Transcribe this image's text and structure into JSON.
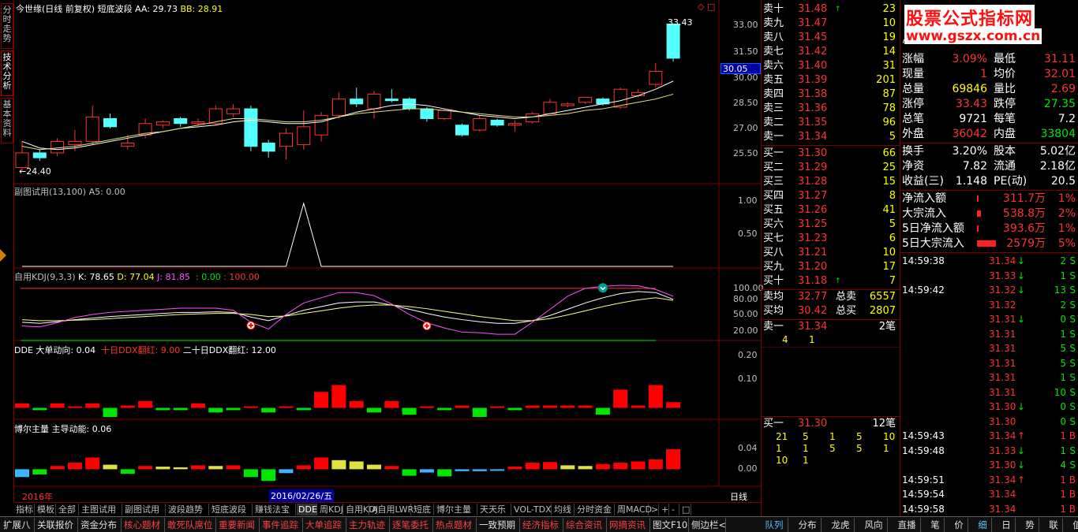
{
  "left_tabs": [
    "分时走势",
    "技术分析",
    "基本资料"
  ],
  "main_chart": {
    "title": "今世缘",
    "period": "(日线 前复权)",
    "indicator": "短底波段",
    "aa_label": "AA: 29.73",
    "bb_label": "BB: 28.91",
    "high_label": "33.43",
    "low_label": "24.40",
    "current_price_label": "30.05",
    "y_ticks": [
      "33.00",
      "31.50",
      "30.00",
      "28.50",
      "27.00",
      "25.50"
    ],
    "colors": {
      "up": "#ff3232",
      "down": "#54ffff",
      "aa": "#ffffff",
      "bb": "#e0e080"
    }
  },
  "chart_data": [
    {
      "type": "candlestick",
      "title": "今世缘 (日线 前复权) 短底波段",
      "candles": [
        {
          "o": 24.6,
          "c": 25.5,
          "h": 26.2,
          "l": 24.4
        },
        {
          "o": 25.5,
          "c": 25.2,
          "h": 25.7,
          "l": 25.0
        },
        {
          "o": 25.5,
          "c": 26.2,
          "h": 26.4,
          "l": 25.3
        },
        {
          "o": 26.0,
          "c": 26.2,
          "h": 26.9,
          "l": 25.6
        },
        {
          "o": 26.2,
          "c": 27.7,
          "h": 28.4,
          "l": 26.0
        },
        {
          "o": 27.6,
          "c": 27.1,
          "h": 27.9,
          "l": 27.0
        },
        {
          "o": 25.9,
          "c": 26.1,
          "h": 26.6,
          "l": 25.7
        },
        {
          "o": 26.6,
          "c": 27.3,
          "h": 27.6,
          "l": 26.4
        },
        {
          "o": 27.2,
          "c": 27.4,
          "h": 27.5,
          "l": 27.0
        },
        {
          "o": 27.6,
          "c": 27.3,
          "h": 27.7,
          "l": 27.1
        },
        {
          "o": 27.3,
          "c": 27.4,
          "h": 27.6,
          "l": 27.2
        },
        {
          "o": 27.3,
          "c": 28.2,
          "h": 28.4,
          "l": 27.2
        },
        {
          "o": 27.9,
          "c": 28.2,
          "h": 28.5,
          "l": 27.7
        },
        {
          "o": 28.2,
          "c": 25.9,
          "h": 28.4,
          "l": 25.6
        },
        {
          "o": 26.1,
          "c": 25.6,
          "h": 26.3,
          "l": 25.2
        },
        {
          "o": 25.9,
          "c": 26.7,
          "h": 27.0,
          "l": 25.1
        },
        {
          "o": 26.0,
          "c": 27.1,
          "h": 28.1,
          "l": 25.7
        },
        {
          "o": 26.6,
          "c": 27.8,
          "h": 28.0,
          "l": 26.2
        },
        {
          "o": 27.8,
          "c": 28.8,
          "h": 29.2,
          "l": 27.6
        },
        {
          "o": 28.8,
          "c": 28.5,
          "h": 29.5,
          "l": 28.3
        },
        {
          "o": 28.2,
          "c": 29.1,
          "h": 29.3,
          "l": 27.6
        },
        {
          "o": 28.8,
          "c": 28.7,
          "h": 29.4,
          "l": 28.6
        },
        {
          "o": 28.8,
          "c": 28.2,
          "h": 28.9,
          "l": 28.1
        },
        {
          "o": 28.2,
          "c": 27.6,
          "h": 28.3,
          "l": 27.4
        },
        {
          "o": 27.6,
          "c": 28.1,
          "h": 28.2,
          "l": 27.5
        },
        {
          "o": 27.2,
          "c": 26.6,
          "h": 27.3,
          "l": 26.5
        },
        {
          "o": 26.9,
          "c": 27.6,
          "h": 27.8,
          "l": 26.8
        },
        {
          "o": 27.5,
          "c": 27.2,
          "h": 27.6,
          "l": 27.1
        },
        {
          "o": 27.2,
          "c": 27.3,
          "h": 27.5,
          "l": 26.8
        },
        {
          "o": 27.4,
          "c": 27.9,
          "h": 28.0,
          "l": 27.3
        },
        {
          "o": 27.9,
          "c": 28.6,
          "h": 28.8,
          "l": 27.9
        },
        {
          "o": 28.4,
          "c": 28.5,
          "h": 28.6,
          "l": 28.3
        },
        {
          "o": 28.6,
          "c": 28.9,
          "h": 28.9,
          "l": 28.5
        },
        {
          "o": 28.8,
          "c": 28.5,
          "h": 28.9,
          "l": 28.4
        },
        {
          "o": 28.3,
          "c": 29.4,
          "h": 29.5,
          "l": 28.2
        },
        {
          "o": 29.0,
          "c": 29.2,
          "h": 29.4,
          "l": 28.9
        },
        {
          "o": 29.7,
          "c": 30.5,
          "h": 31.0,
          "l": 29.5
        },
        {
          "o": 33.4,
          "c": 31.3,
          "h": 33.43,
          "l": 31.1
        }
      ],
      "aa": [
        26.2,
        25.8,
        25.7,
        25.8,
        26.0,
        26.2,
        26.4,
        26.6,
        26.8,
        27.0,
        27.1,
        27.2,
        27.4,
        27.5,
        27.4,
        27.3,
        27.3,
        27.4,
        27.7,
        28.0,
        28.2,
        28.4,
        28.5,
        28.4,
        28.2,
        28.0,
        27.8,
        27.7,
        27.6,
        27.7,
        27.9,
        28.1,
        28.3,
        28.5,
        28.7,
        29.0,
        29.4,
        29.9
      ],
      "bb": [
        25.9,
        25.7,
        25.8,
        25.9,
        26.1,
        26.3,
        26.5,
        26.7,
        26.8,
        27.0,
        27.2,
        27.4,
        27.6,
        27.6,
        27.5,
        27.4,
        27.4,
        27.5,
        27.7,
        27.9,
        28.0,
        28.1,
        28.2,
        28.2,
        28.1,
        28.0,
        27.9,
        27.8,
        27.7,
        27.7,
        27.8,
        27.9,
        28.1,
        28.2,
        28.4,
        28.6,
        28.8,
        29.1
      ],
      "ylim": [
        24.0,
        34.0
      ]
    },
    {
      "type": "line",
      "title": "副图试用(13,100) A5: 0.00",
      "values": [
        0,
        0,
        0,
        0,
        0,
        0,
        0,
        0,
        0,
        0,
        0,
        0,
        0,
        0,
        0,
        0,
        1.0,
        0,
        0,
        0,
        0,
        0,
        0,
        0,
        0,
        0,
        0,
        0,
        0,
        0,
        0,
        0,
        0,
        0,
        0,
        0,
        0,
        0
      ],
      "ylim": [
        0,
        1.15
      ],
      "y_ticks": [
        "1.00",
        "0.50"
      ]
    },
    {
      "type": "line",
      "title": "自用KDJ(9,3,3)",
      "series": [
        {
          "name": "K",
          "values": [
            35,
            33,
            36,
            40,
            43,
            46,
            48,
            50,
            52,
            54,
            54,
            55,
            54,
            45,
            38,
            48,
            58,
            65,
            72,
            74,
            74,
            68,
            60,
            52,
            45,
            40,
            36,
            33,
            33,
            38,
            48,
            60,
            72,
            82,
            90,
            94,
            92,
            79
          ]
        },
        {
          "name": "D",
          "values": [
            40,
            38,
            38,
            39,
            40,
            42,
            44,
            46,
            48,
            50,
            51,
            52,
            52,
            50,
            46,
            47,
            52,
            57,
            62,
            66,
            68,
            68,
            65,
            61,
            56,
            51,
            46,
            42,
            38,
            38,
            42,
            49,
            57,
            65,
            72,
            78,
            82,
            77
          ]
        },
        {
          "name": "J",
          "values": [
            28,
            26,
            34,
            44,
            50,
            54,
            56,
            58,
            60,
            62,
            62,
            62,
            58,
            35,
            22,
            50,
            72,
            82,
            92,
            92,
            86,
            70,
            50,
            34,
            24,
            16,
            15,
            12,
            12,
            35,
            60,
            85,
            100,
            104,
            106,
            105,
            98,
            85
          ]
        }
      ],
      "k_label": "K: 78.65",
      "d_label": "D: 77.04",
      "j_label": "J: 81.85",
      "zero_label": ": 0.00",
      "hundred_label": ": 100.00",
      "y_ticks": [
        "100.00",
        "80.00",
        "50.00",
        "20.00"
      ],
      "ylim": [
        0,
        115
      ],
      "buy_marks": [
        13,
        23
      ],
      "sell_marks": [
        33
      ]
    },
    {
      "type": "bar",
      "title": "DDE",
      "large_label": "大单动向: 0.04",
      "ten_label": "十日DDX翻红: 9.00",
      "twenty_label": "二十日DDX翻红: 12.00",
      "values": [
        0.02,
        -0.01,
        0.02,
        0.0,
        0.02,
        -0.04,
        0.01,
        0.03,
        -0.01,
        -0.01,
        0.02,
        -0.02,
        -0.01,
        0.0,
        -0.02,
        0.0,
        -0.01,
        0.07,
        0.1,
        0.03,
        -0.02,
        0.03,
        -0.03,
        0.0,
        -0.01,
        0.01,
        -0.04,
        0.0,
        -0.01,
        0.01,
        0.01,
        0.01,
        0.01,
        -0.03,
        0.08,
        0.01,
        0.1,
        0.025
      ],
      "ylim": [
        -0.05,
        0.24
      ],
      "y_ticks": [
        "0.20",
        "0.10"
      ]
    },
    {
      "type": "bar",
      "title": "博尔主量",
      "energy_label": "主导动能: 0.06",
      "values": [
        -0.012,
        -0.008,
        0.005,
        0.01,
        0.018,
        0.007,
        -0.007,
        0.005,
        0.004,
        0.003,
        0.006,
        0.005,
        0.006,
        -0.012,
        -0.018,
        -0.006,
        0.006,
        0.018,
        0.014,
        0.012,
        0.007,
        0.005,
        -0.01,
        -0.005,
        -0.011,
        -0.003,
        -0.003,
        -0.002,
        0.004,
        0.01,
        0.011,
        0.006,
        0.005,
        0.008,
        0.01,
        0.012,
        0.015,
        0.031
      ],
      "colors": [
        "#3cb4ff",
        "#00e600",
        "#ff0000",
        "#ff0000",
        "#ff0000",
        "#e0e040",
        "#00e600",
        "#ff0000",
        "#e0e040",
        "#e0e040",
        "#ff0000",
        "#e0e040",
        "#ff0000",
        "#00e600",
        "#00e600",
        "#3cb4ff",
        "#ff0000",
        "#ff0000",
        "#e0e040",
        "#e0e040",
        "#e0e040",
        "#ff0000",
        "#00e600",
        "#3cb4ff",
        "#00e600",
        "#3cb4ff",
        "#3cb4ff",
        "#3cb4ff",
        "#ff0000",
        "#ff0000",
        "#ff0000",
        "#e0e040",
        "#e0e040",
        "#ff0000",
        "#ff0000",
        "#ff0000",
        "#ff0000",
        "#ff0000"
      ],
      "ylim": [
        -0.025,
        0.055
      ],
      "y_ticks": [
        "0.04",
        "0.00"
      ]
    }
  ],
  "time_axis": {
    "year_label": "2016年",
    "cursor_date": "2016/02/26/五",
    "period_label": "日线"
  },
  "asks": [
    {
      "label": "卖十",
      "price": "31.48",
      "vol": "23",
      "flag": "↑"
    },
    {
      "label": "卖九",
      "price": "31.47",
      "vol": "10",
      "flag": ""
    },
    {
      "label": "卖八",
      "price": "31.45",
      "vol": "19",
      "flag": ""
    },
    {
      "label": "卖七",
      "price": "31.42",
      "vol": "14",
      "flag": ""
    },
    {
      "label": "卖六",
      "price": "31.40",
      "vol": "31",
      "flag": ""
    },
    {
      "label": "卖五",
      "price": "31.39",
      "vol": "201",
      "flag": ""
    },
    {
      "label": "卖四",
      "price": "31.38",
      "vol": "87",
      "flag": ""
    },
    {
      "label": "卖三",
      "price": "31.36",
      "vol": "78",
      "flag": ""
    },
    {
      "label": "卖二",
      "price": "31.35",
      "vol": "96",
      "flag": ""
    },
    {
      "label": "卖一",
      "price": "31.34",
      "vol": "5",
      "flag": ""
    }
  ],
  "bids": [
    {
      "label": "买一",
      "price": "31.30",
      "vol": "66",
      "flag": ""
    },
    {
      "label": "买二",
      "price": "31.29",
      "vol": "25",
      "flag": ""
    },
    {
      "label": "买三",
      "price": "31.28",
      "vol": "15",
      "flag": ""
    },
    {
      "label": "买四",
      "price": "31.27",
      "vol": "8",
      "flag": ""
    },
    {
      "label": "买五",
      "price": "31.26",
      "vol": "41",
      "flag": ""
    },
    {
      "label": "买六",
      "price": "31.25",
      "vol": "5",
      "flag": ""
    },
    {
      "label": "买七",
      "price": "31.23",
      "vol": "6",
      "flag": ""
    },
    {
      "label": "买八",
      "price": "31.21",
      "vol": "10",
      "flag": ""
    },
    {
      "label": "买九",
      "price": "31.20",
      "vol": "17",
      "flag": ""
    },
    {
      "label": "买十",
      "price": "31.18",
      "vol": "7",
      "flag": "↑"
    }
  ],
  "avg": {
    "sell_avg_label": "卖均",
    "sell_avg": "32.77",
    "total_sell_label": "总卖",
    "total_sell": "6557",
    "buy_avg_label": "买均",
    "buy_avg": "30.42",
    "total_buy_label": "总买",
    "total_buy": "2807"
  },
  "ask1_detail": {
    "label": "卖一",
    "price": "31.34",
    "count": "2笔",
    "orders": [
      "4",
      "1"
    ]
  },
  "bid1_detail": {
    "label": "买一",
    "price": "31.30",
    "count": "12笔",
    "orders_row1": [
      "21",
      "5",
      "1",
      "5",
      "10"
    ],
    "orders_row2": [
      "1",
      "1",
      "5",
      "5",
      "1"
    ],
    "orders_row3": [
      "10",
      "1"
    ]
  },
  "watermark": {
    "title": "股票公式指标网",
    "url": "www.gszx.com.cn"
  },
  "stats_partial": {
    "left": "涨跌",
    "right": "最高"
  },
  "stats": [
    {
      "l1": "涨幅",
      "v1": "3.09%",
      "c1": "red",
      "l2": "最低",
      "v2": "31.11",
      "c2": "red"
    },
    {
      "l1": "现量",
      "v1": "1",
      "c1": "red",
      "l2": "均价",
      "v2": "32.01",
      "c2": "red"
    },
    {
      "l1": "总量",
      "v1": "69846",
      "c1": "yellow",
      "l2": "量比",
      "v2": "2.69",
      "c2": "red"
    },
    {
      "l1": "涨停",
      "v1": "33.43",
      "c1": "red",
      "l2": "跌停",
      "v2": "27.35",
      "c2": "green"
    },
    {
      "l1": "总笔",
      "v1": "9721",
      "c1": "white",
      "l2": "每笔",
      "v2": "7.2",
      "c2": "white"
    },
    {
      "l1": "外盘",
      "v1": "36042",
      "c1": "red",
      "l2": "内盘",
      "v2": "33804",
      "c2": "green"
    },
    {
      "l1": "换手",
      "v1": "3.20%",
      "c1": "white",
      "l2": "股本",
      "v2": "5.02亿",
      "c2": "white"
    },
    {
      "l1": "净资",
      "v1": "7.82",
      "c1": "white",
      "l2": "流通",
      "v2": "2.18亿",
      "c2": "white"
    },
    {
      "l1": "收益(三)",
      "v1": "1.148",
      "c1": "white",
      "l2": "PE(动)",
      "v2": "20.5",
      "c2": "white"
    }
  ],
  "flows": [
    {
      "label": "净流入额",
      "value": "311.7万",
      "pct": "1%",
      "bar": 0.05
    },
    {
      "label": "大宗流入",
      "value": "538.8万",
      "pct": "2%",
      "bar": 0.1
    },
    {
      "label": "5日净流入额",
      "value": "393.6万",
      "pct": "1%",
      "bar": 0.05
    },
    {
      "label": "5日大宗流入",
      "value": "2579万",
      "pct": "5%",
      "bar": 0.5
    }
  ],
  "ticks": [
    {
      "time": "14:59:38",
      "price": "31.34",
      "arrow": "↓",
      "ac": "green",
      "vol": "2",
      "side": "S",
      "sc": "green"
    },
    {
      "time": "",
      "price": "31.33",
      "arrow": "↓",
      "ac": "green",
      "vol": "1",
      "side": "S",
      "sc": "green"
    },
    {
      "time": "14:59:42",
      "price": "31.32",
      "arrow": "↓",
      "ac": "green",
      "vol": "13",
      "side": "S",
      "sc": "green"
    },
    {
      "time": "",
      "price": "31.32",
      "arrow": "",
      "ac": "",
      "vol": "2",
      "side": "S",
      "sc": "green"
    },
    {
      "time": "",
      "price": "31.31",
      "arrow": "↓",
      "ac": "green",
      "vol": "0",
      "side": "S",
      "sc": "green"
    },
    {
      "time": "",
      "price": "31.31",
      "arrow": "",
      "ac": "",
      "vol": "1",
      "side": "S",
      "sc": "green"
    },
    {
      "time": "",
      "price": "31.31",
      "arrow": "",
      "ac": "",
      "vol": "5",
      "side": "S",
      "sc": "green"
    },
    {
      "time": "",
      "price": "31.31",
      "arrow": "",
      "ac": "",
      "vol": "5",
      "side": "S",
      "sc": "green"
    },
    {
      "time": "",
      "price": "31.31",
      "arrow": "",
      "ac": "",
      "vol": "1",
      "side": "S",
      "sc": "green"
    },
    {
      "time": "",
      "price": "31.31",
      "arrow": "",
      "ac": "",
      "vol": "10",
      "side": "S",
      "sc": "green"
    },
    {
      "time": "",
      "price": "31.30",
      "arrow": "↓",
      "ac": "green",
      "vol": "0",
      "side": "S",
      "sc": "green"
    },
    {
      "time": "",
      "price": "31.30",
      "arrow": "",
      "ac": "",
      "vol": "0",
      "side": "S",
      "sc": "green"
    },
    {
      "time": "14:59:43",
      "price": "31.34",
      "arrow": "↑",
      "ac": "red",
      "vol": "1",
      "side": "B",
      "sc": "red"
    },
    {
      "time": "14:59:48",
      "price": "31.33",
      "arrow": "↓",
      "ac": "green",
      "vol": "1",
      "side": "S",
      "sc": "green"
    },
    {
      "time": "",
      "price": "31.30",
      "arrow": "↓",
      "ac": "green",
      "vol": "4",
      "side": "S",
      "sc": "green"
    },
    {
      "time": "14:59:51",
      "price": "31.34",
      "arrow": "↑",
      "ac": "red",
      "vol": "1",
      "side": "B",
      "sc": "red"
    },
    {
      "time": "14:59:54",
      "price": "31.34",
      "arrow": "",
      "ac": "",
      "vol": "1",
      "side": "B",
      "sc": "red"
    },
    {
      "time": "14:59:58",
      "price": "31.34",
      "arrow": "",
      "ac": "",
      "vol": "1",
      "side": "B",
      "sc": "red"
    }
  ],
  "tick_vols": [
    "2",
    "1",
    "13",
    "2",
    "0",
    "1",
    "5",
    "5",
    "1",
    "10",
    "0",
    "0",
    "1",
    "1",
    "4",
    "1",
    "1",
    "1"
  ],
  "tick_sides": [
    "S",
    "S",
    "S",
    "S",
    "S",
    "S",
    "S",
    "S",
    "S",
    "S",
    "S",
    "S",
    "B",
    "S",
    "S",
    "B",
    "B",
    "B"
  ],
  "indicator_tabs": [
    "指标",
    "模板",
    "全部",
    "主图试用",
    "副图试用",
    "波段趋势",
    "短底波段",
    "赚钱法宝",
    "DDE",
    "周KDJ",
    "自用KDJ",
    "A自用LWR",
    "短底",
    "博尔主量",
    "天天乐",
    "VOL-TDX",
    "均线",
    "分时资金",
    "周MACD",
    ">",
    "+",
    "-",
    "□"
  ],
  "bottom_tabs": [
    "扩展八",
    "关联报价",
    "资金分布",
    "核心题材",
    "敢死队席位",
    "重要新闻",
    "事件追踪",
    "大单追踪",
    "主力轨迹",
    "逐笔委托",
    "热点题材",
    "一致预期",
    "经济指标",
    "综合资讯",
    "网摘资讯",
    "图文F10",
    "侧边栏<"
  ],
  "right_bottom_tabs": [
    "队列",
    "分布",
    "龙虎",
    "风向",
    "直播",
    "笔",
    "价",
    "细",
    "日",
    "势",
    "联",
    "值",
    "筹"
  ]
}
